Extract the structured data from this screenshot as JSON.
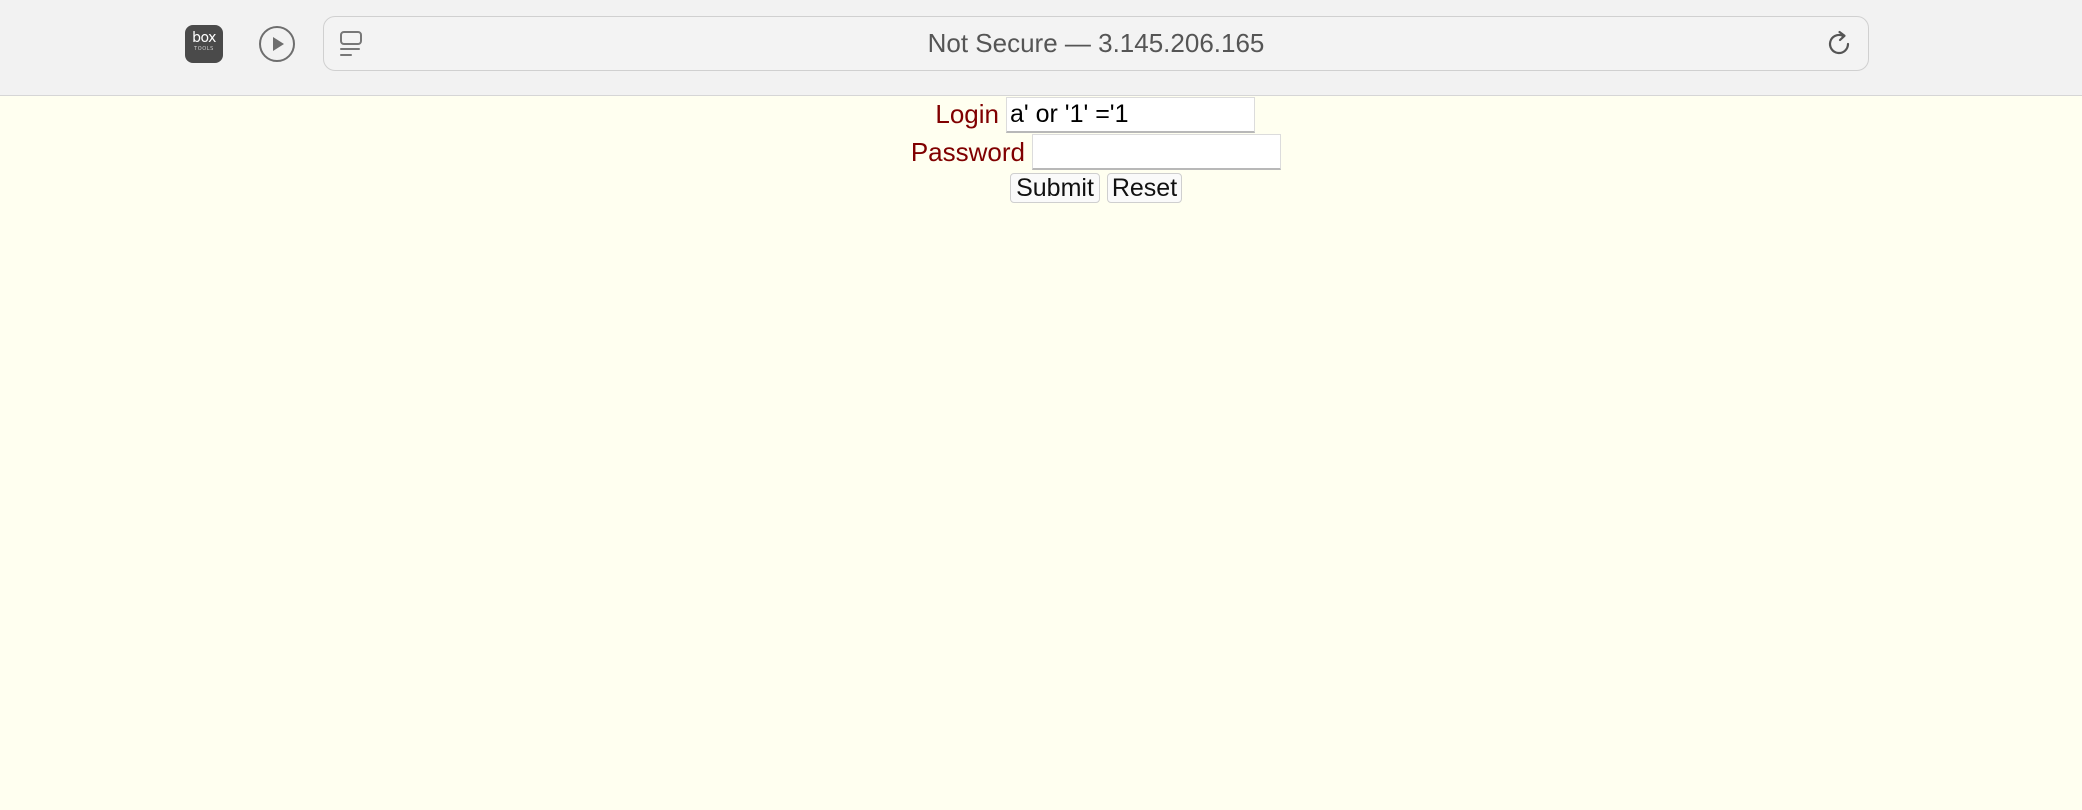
{
  "browser": {
    "extension_icon": {
      "name": "box-tools-icon",
      "word": "box",
      "subword": "TOOLS"
    },
    "address_bar": {
      "url_text": "Not Secure — 3.145.206.165"
    },
    "icons": [
      "play-icon",
      "tab-overview-icon",
      "reload-icon"
    ]
  },
  "page": {
    "background_color": "#fffff0",
    "label_color": "#800000",
    "form": {
      "login_label": "Login",
      "login_value": "a' or '1' ='1",
      "password_label": "Password",
      "password_value": "",
      "submit_label": "Submit",
      "reset_label": "Reset"
    }
  }
}
